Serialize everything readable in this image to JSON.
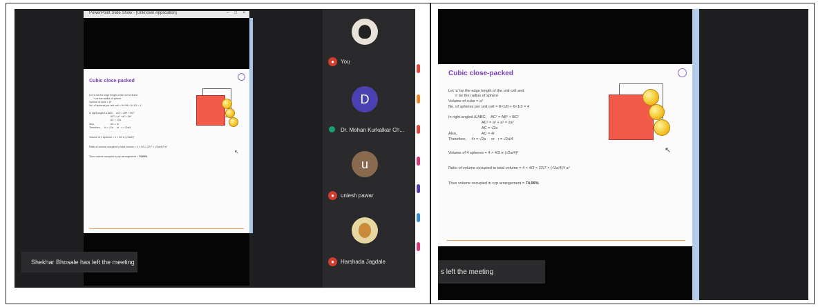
{
  "left_panel": {
    "window_title": "PowerPoint Slide Show - [Unknown Application]",
    "window_controls": [
      "–",
      "□",
      "×"
    ],
    "slide": {
      "title": "Cubic close-packed",
      "lines": [
        "Let 'a' be the edge length of the unit cell and",
        "      'r' be the radius of sphere",
        "Volume of cube = a³",
        "No. of spheres per unit cell = 8×1/8 + 6×1/2 = 4",
        "In right angled Δ ABC,    AC² = AB² + BC²",
        "                               AC² = a² + a² = 2a²",
        "                               AC = √2a",
        "Also,                       AC = 4r",
        "Therefore,     4r = √2a     or   r = √2a/4",
        "Volume of 4 spheres = 4 × 4/3 π (√2a/4)³",
        "Ratio of volume occupied to total volume = 4 × 4/3 × 22/7 × (√2a/4)³/ a³",
        "Thus volume occupied in ccp arrangement = "
      ],
      "result": "74.06%"
    },
    "toast": "Shekhar Bhosale has left the meeting",
    "participants": [
      {
        "name": "You",
        "initial": "",
        "color": "#e9e2d8"
      },
      {
        "name": "Dr. Mohan Kurkalkar Ch...",
        "initial": "D",
        "color": "#4a3fb3"
      },
      {
        "name": "uniesh pawar",
        "initial": "u",
        "color": "#8a6a4e"
      },
      {
        "name": "Harshada Jagdale",
        "initial": "",
        "color": "#e8d7a0"
      }
    ]
  },
  "right_panel": {
    "slide": {
      "title": "Cubic close-packed",
      "lines": [
        "Let 'a' be the edge length of the unit cell and",
        "      'r' be the radius of sphere",
        "Volume of cube = a³",
        "No. of spheres per unit cell = 8×1/8 + 6×1/2 = 4",
        "In right angled Δ ABC,    AC² = AB² + BC²",
        "                               AC² = a² + a² = 2a²",
        "                               AC = √2a",
        "Also,                       AC = 4r",
        "Therefore,     4r = √2a     or   r = √2a/4",
        "Volume of 4 spheres = 4 × 4/3 π (√2a/4)³",
        "Ratio of volume occupied to total volume = 4 × 4/3 × 22/7 × (√2a/4)³/ a³",
        "Thus volume occupied in ccp arrangement = "
      ],
      "result": "74.06%"
    },
    "toast": "s left the meeting"
  }
}
